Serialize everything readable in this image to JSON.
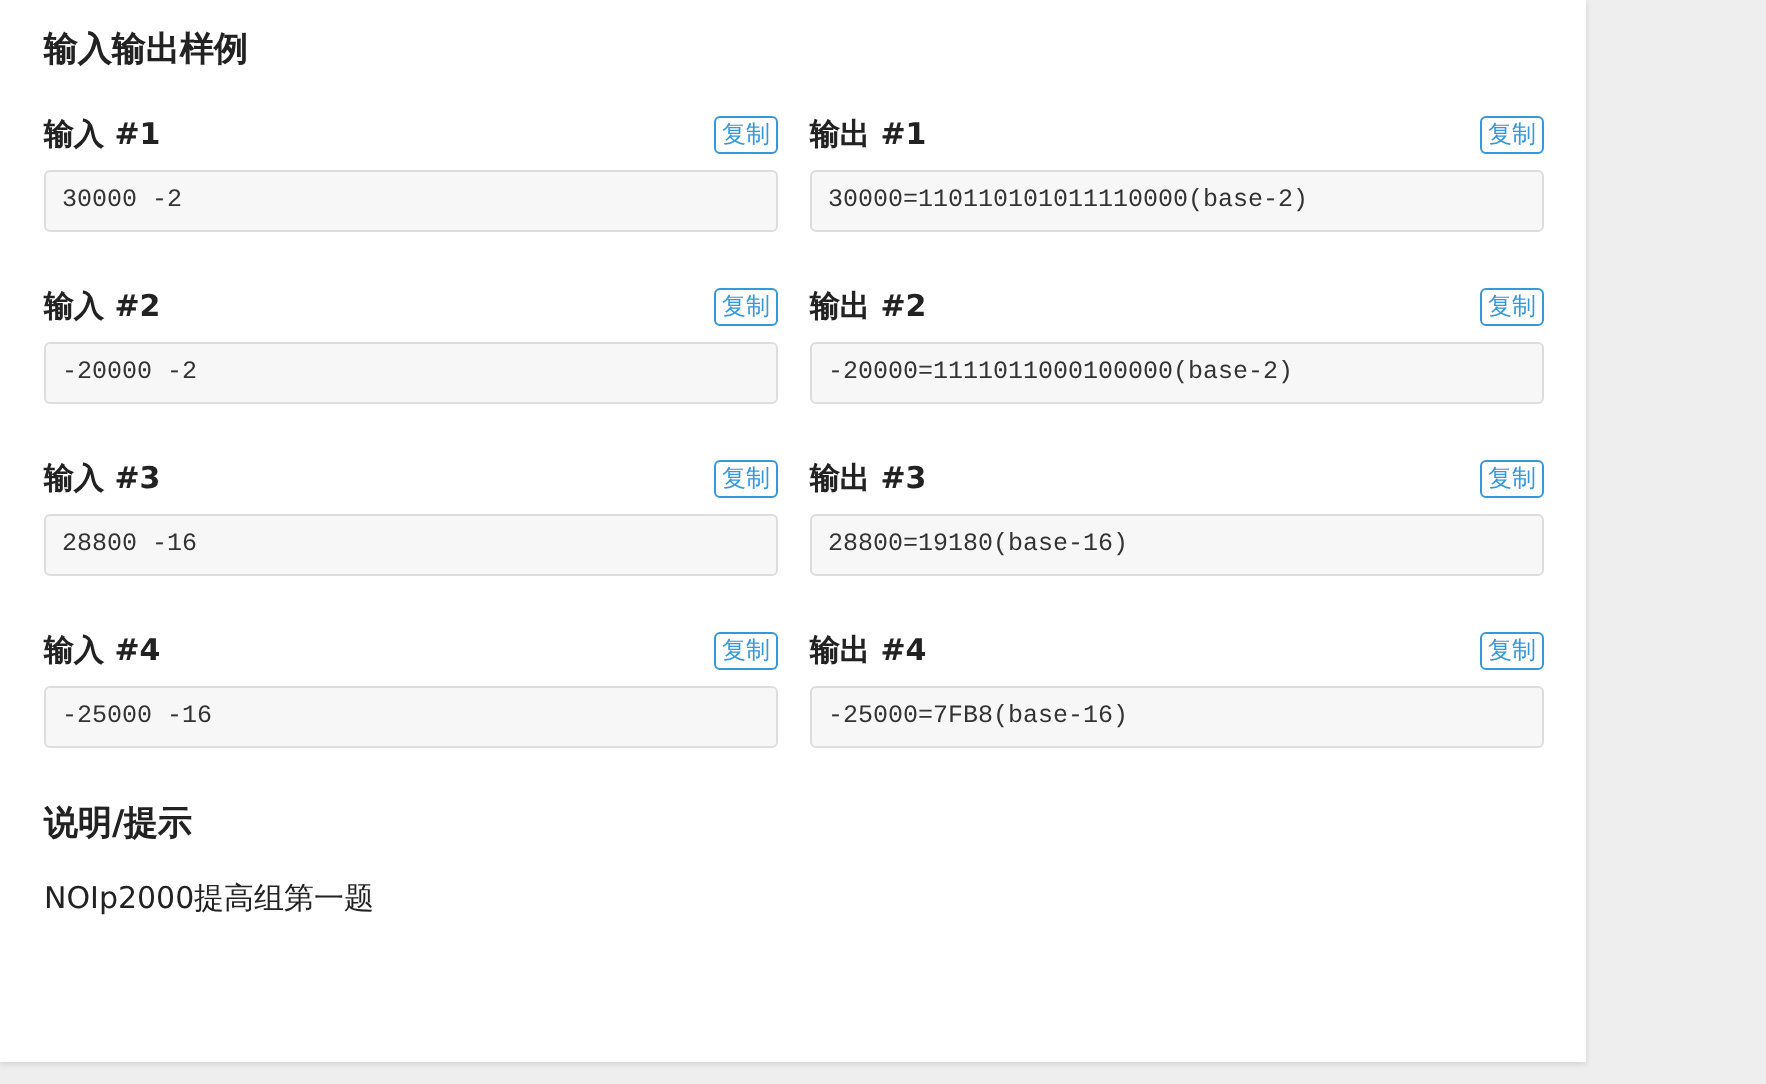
{
  "samples_title": "输入输出样例",
  "samples": [
    {
      "input": {
        "label": "输入 #1",
        "copy": "复制",
        "content": "30000 -2"
      },
      "output": {
        "label": "输出 #1",
        "copy": "复制",
        "content": "30000=110110101011110000(base-2)"
      }
    },
    {
      "input": {
        "label": "输入 #2",
        "copy": "复制",
        "content": "-20000 -2"
      },
      "output": {
        "label": "输出 #2",
        "copy": "复制",
        "content": "-20000=1111011000100000(base-2)"
      }
    },
    {
      "input": {
        "label": "输入 #3",
        "copy": "复制",
        "content": "28800 -16"
      },
      "output": {
        "label": "输出 #3",
        "copy": "复制",
        "content": "28800=19180(base-16)"
      }
    },
    {
      "input": {
        "label": "输入 #4",
        "copy": "复制",
        "content": "-25000 -16"
      },
      "output": {
        "label": "输出 #4",
        "copy": "复制",
        "content": "-25000=7FB8(base-16)"
      }
    }
  ],
  "hint": {
    "title": "说明/提示",
    "text": "NOIp2000提高组第一题"
  }
}
